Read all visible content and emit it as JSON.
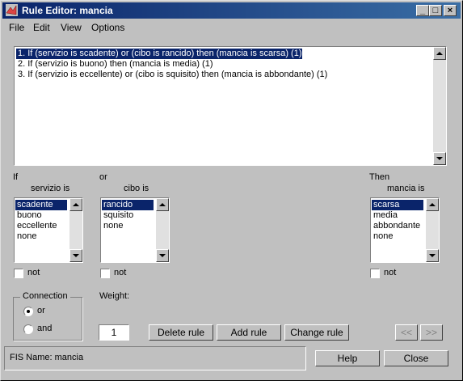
{
  "window": {
    "title": "Rule Editor: mancia"
  },
  "menu": [
    "File",
    "Edit",
    "View",
    "Options"
  ],
  "rules": [
    "1. If (servizio is scadente) or (cibo is rancido) then (mancia is scarsa) (1)",
    "2. If (servizio is buono) then (mancia is media) (1)",
    "3. If (servizio is eccellente) or (cibo is squisito) then (mancia is abbondante) (1)"
  ],
  "labels": {
    "if": "If",
    "or": "or",
    "then": "Then",
    "weight": "Weight:",
    "not": "not"
  },
  "inputs": [
    {
      "title": "servizio is",
      "items": [
        "scadente",
        "buono",
        "eccellente",
        "none"
      ],
      "selected": 0
    },
    {
      "title": "cibo is",
      "items": [
        "rancido",
        "squisito",
        "none"
      ],
      "selected": 0
    }
  ],
  "output": {
    "title": "mancia is",
    "items": [
      "scarsa",
      "media",
      "abbondante",
      "none"
    ],
    "selected": 0
  },
  "connection": {
    "title": "Connection",
    "options": [
      "or",
      "and"
    ],
    "selected": "or"
  },
  "weight_value": "1",
  "buttons": {
    "delete": "Delete rule",
    "add": "Add rule",
    "change": "Change rule",
    "prev": "<<",
    "next": ">>",
    "help": "Help",
    "close": "Close"
  },
  "status": "FIS Name: mancia"
}
